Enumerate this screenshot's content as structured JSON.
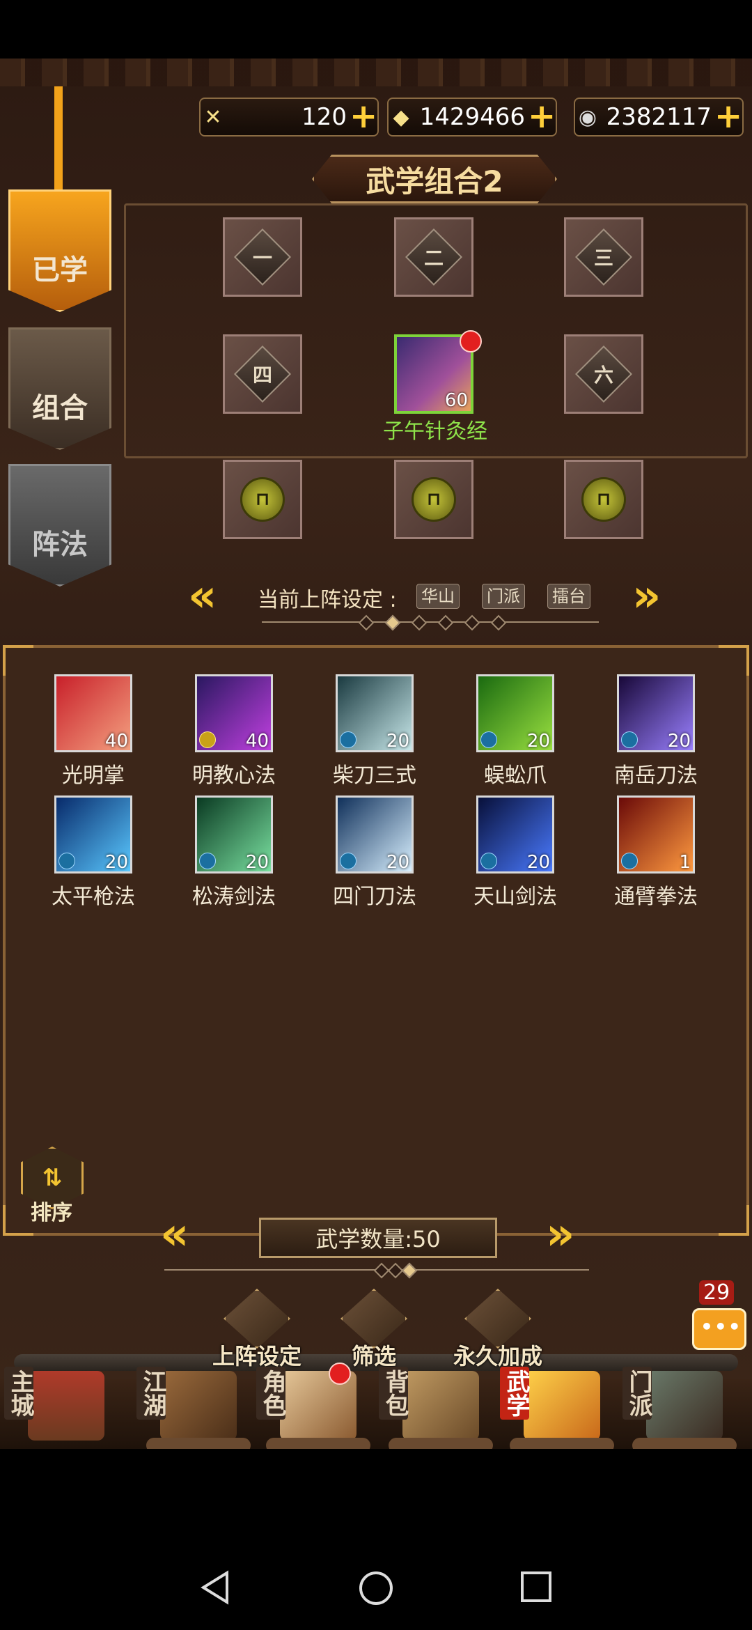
{
  "currencies": [
    {
      "icon": "stamina-icon",
      "value": "120"
    },
    {
      "icon": "ingot-icon",
      "value": "1429466"
    },
    {
      "icon": "silver-coin-icon",
      "value": "2382117"
    }
  ],
  "side_tabs": [
    {
      "label": "已学",
      "state": "active"
    },
    {
      "label": "组合",
      "state": "normal"
    },
    {
      "label": "阵法",
      "state": "disabled"
    }
  ],
  "combo": {
    "title": "武学组合2",
    "slots": [
      {
        "label": "一",
        "type": "empty"
      },
      {
        "label": "二",
        "type": "empty"
      },
      {
        "label": "三",
        "type": "empty"
      },
      {
        "label": "四",
        "type": "empty"
      },
      {
        "label": "",
        "type": "skill",
        "skill_name": "子午针灸经",
        "level": "60"
      },
      {
        "label": "六",
        "type": "empty"
      },
      {
        "label": "",
        "type": "locked"
      },
      {
        "label": "",
        "type": "locked"
      },
      {
        "label": "",
        "type": "locked"
      }
    ]
  },
  "preset": {
    "label": "当前上阵设定 :",
    "tags": [
      "华山",
      "门派",
      "擂台"
    ]
  },
  "skills": [
    {
      "name": "光明掌",
      "level": "40",
      "badge": "none",
      "colors": [
        "#c8202a",
        "#f4a080"
      ]
    },
    {
      "name": "明教心法",
      "level": "40",
      "badge": "gold",
      "colors": [
        "#2a1860",
        "#c040e0"
      ]
    },
    {
      "name": "柴刀三式",
      "level": "20",
      "badge": "blue",
      "colors": [
        "#1a3a40",
        "#c8e8ea"
      ]
    },
    {
      "name": "蜈蚣爪",
      "level": "20",
      "badge": "blue",
      "colors": [
        "#1a6a10",
        "#9ae040"
      ]
    },
    {
      "name": "南岳刀法",
      "level": "20",
      "badge": "blue",
      "colors": [
        "#180838",
        "#9a80ff"
      ]
    },
    {
      "name": "太平枪法",
      "level": "20",
      "badge": "blue",
      "colors": [
        "#082a6a",
        "#5ac8ff"
      ]
    },
    {
      "name": "松涛剑法",
      "level": "20",
      "badge": "blue",
      "colors": [
        "#0a3a22",
        "#7ae0a0"
      ]
    },
    {
      "name": "四门刀法",
      "level": "20",
      "badge": "blue",
      "colors": [
        "#10305a",
        "#d8f0ff"
      ]
    },
    {
      "name": "天山剑法",
      "level": "20",
      "badge": "blue",
      "colors": [
        "#08103a",
        "#4a7aff"
      ]
    },
    {
      "name": "通臂拳法",
      "level": "1",
      "badge": "blue",
      "colors": [
        "#6a0a08",
        "#ff9a40"
      ]
    }
  ],
  "list": {
    "sort_label": "排序",
    "count_label": "武学数量:50"
  },
  "actions": [
    {
      "label": "上阵设定",
      "icon": "formation-icon"
    },
    {
      "label": "筛选",
      "icon": "filter-icon"
    },
    {
      "label": "永久加成",
      "icon": "bonus-icon"
    }
  ],
  "chat": {
    "count": "29"
  },
  "nav": [
    {
      "label": "主城",
      "icon": "city-icon"
    },
    {
      "label": "江湖",
      "icon": "jianghu-icon"
    },
    {
      "label": "角色",
      "icon": "character-icon"
    },
    {
      "label": "背包",
      "icon": "bag-icon"
    },
    {
      "label": "武学",
      "icon": "martial-arts-icon",
      "active": true
    },
    {
      "label": "门派",
      "icon": "sect-icon"
    }
  ]
}
